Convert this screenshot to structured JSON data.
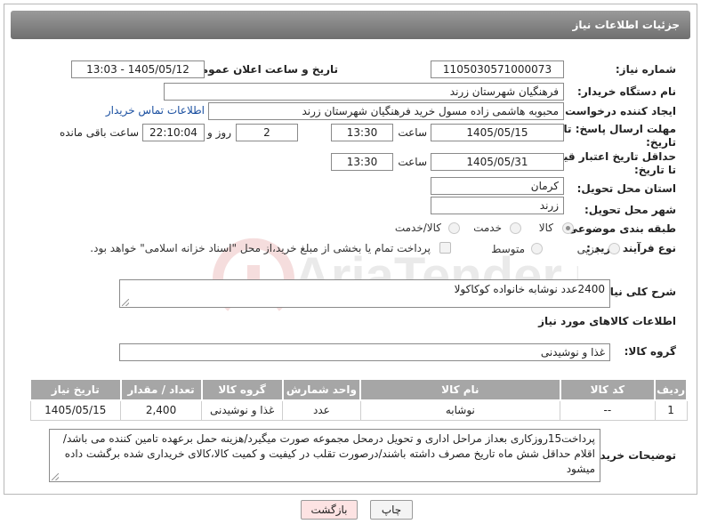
{
  "header": {
    "title": "جزئیات اطلاعات نیاز"
  },
  "watermark": {
    "text": "AriaTender.neT"
  },
  "fields": {
    "need_number": {
      "label": "شماره نیاز:",
      "value": "1105030571000073"
    },
    "announce_datetime": {
      "label": "تاریخ و ساعت اعلان عمومی:",
      "value": "1405/05/12 - 13:03"
    },
    "buyer_org": {
      "label": "نام دستگاه خریدار:",
      "value": "فرهنگیان شهرستان زرند"
    },
    "requester": {
      "label": "ایجاد کننده درخواست:",
      "value": "محبوبه هاشمی زاده مسول خرید فرهنگیان شهرستان زرند",
      "contact_link": "اطلاعات تماس خریدار"
    },
    "reply_deadline": {
      "label_line1": "مهلت ارسال پاسخ: تا",
      "label_line2": "تاریخ:",
      "date": "1405/05/15",
      "time_label": "ساعت",
      "time": "13:30",
      "days": "2",
      "days_label": "روز و",
      "remaining": "22:10:04",
      "remaining_label": "ساعت باقی مانده"
    },
    "price_validity": {
      "label_line1": "حداقل تاریخ اعتبار قیمت:",
      "label_line2": "تا تاریخ:",
      "date": "1405/05/31",
      "time_label": "ساعت",
      "time": "13:30"
    },
    "province": {
      "label": "استان محل تحویل:",
      "value": "کرمان"
    },
    "city": {
      "label": "شهر محل تحویل:",
      "value": "زرند"
    },
    "category": {
      "label": "طبقه بندی موضوعی:",
      "options": [
        "کالا",
        "خدمت",
        "کالا/خدمت"
      ],
      "selected": "کالا"
    },
    "purchase_type": {
      "label": "نوع فرآیند خرید :",
      "options": [
        "جزیی",
        "متوسط"
      ],
      "payment_note": "پرداخت تمام یا بخشی از مبلغ خرید،از محل \"اسناد خزانه اسلامی\" خواهد بود."
    }
  },
  "description": {
    "label": "شرح کلی نیاز:",
    "value": "2400عدد نوشابه خانواده کوکاکولا"
  },
  "goods_section": {
    "title": "اطلاعات کالاهای مورد نیاز"
  },
  "goods_group": {
    "label": "گروه کالا:",
    "value": "غذا و نوشیدنی"
  },
  "table": {
    "headers": [
      "ردیف",
      "کد کالا",
      "نام کالا",
      "واحد شمارش",
      "گروه کالا",
      "تعداد / مقدار",
      "تاریخ نیاز"
    ],
    "rows": [
      [
        "1",
        "--",
        "نوشابه",
        "عدد",
        "غذا و نوشیدنی",
        "2,400",
        "1405/05/15"
      ]
    ]
  },
  "buyer_notes": {
    "label": "توضیحات خریدار:",
    "value": "پرداخت15روزکاری بعداز مراحل اداری و تحویل درمحل مجموعه صورت میگیرد/هزینه حمل برعهده تامین کننده می باشد/اقلام حداقل شش ماه تاریخ مصرف داشته باشند/درصورت تقلب در کیفیت و کمیت کالا،کالای خریداری شده برگشت داده میشود"
  },
  "buttons": {
    "print": "چاپ",
    "back": "بازگشت"
  },
  "colors": {
    "header_bg": "#7f7f7f",
    "link": "#1a4fa0",
    "back_button_bg": "#fde3e3"
  }
}
